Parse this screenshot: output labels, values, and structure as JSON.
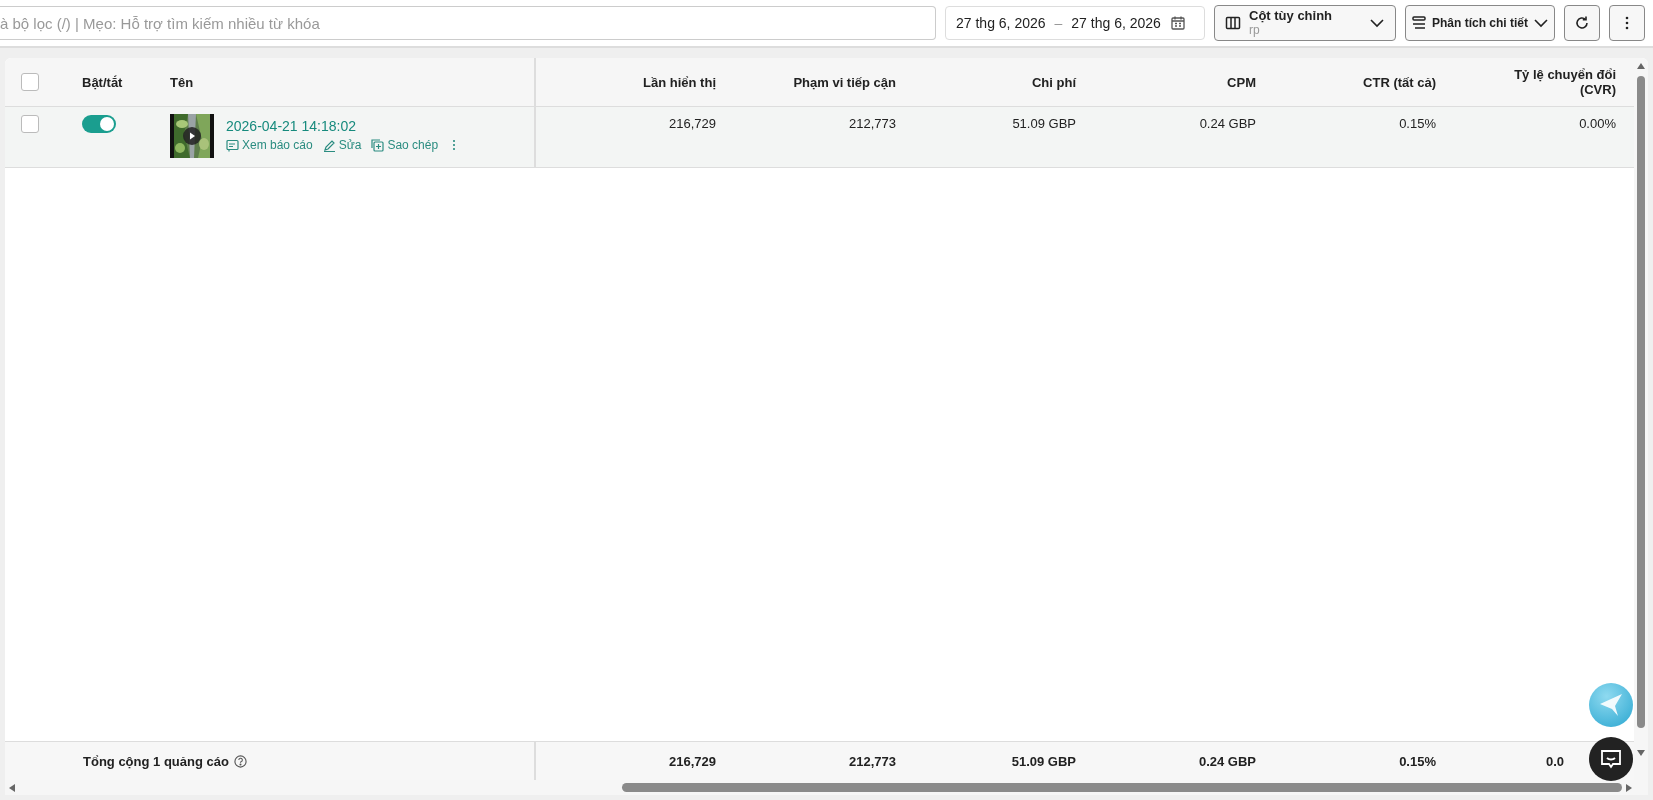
{
  "toolbar": {
    "search": {
      "placeholder": "à bộ lọc (/) | Mẹo: Hỗ trợ tìm kiếm nhiều từ khóa"
    },
    "date_range": {
      "start": "27 thg 6, 2026",
      "separator": "–",
      "end": "27 thg 6, 2026"
    },
    "custom_columns": {
      "label": "Cột tùy chỉnh",
      "sublabel": "rp"
    },
    "breakdown": {
      "label": "Phân tích chi tiết"
    }
  },
  "table": {
    "select_all_checked": false,
    "columns": [
      "Bật/tắt",
      "Tên",
      "Lần hiển thị",
      "Phạm vi tiếp cận",
      "Chi phí",
      "CPM",
      "CTR (tất cả)",
      "Tỷ lệ chuyển đổi (CVR)"
    ],
    "rows": [
      {
        "checked": false,
        "on": true,
        "name": "2026-04-21 14:18:02",
        "actions": [
          "Xem báo cáo",
          "Sửa",
          "Sao chép"
        ],
        "values": [
          "216,729",
          "212,773",
          "51.09 GBP",
          "0.24 GBP",
          "0.15%",
          "0.00%"
        ]
      }
    ],
    "footer": {
      "label": "Tổng cộng 1 quảng cáo",
      "values": [
        "216,729",
        "212,773",
        "51.09 GBP",
        "0.24 GBP",
        "0.15%",
        "0.0"
      ]
    }
  }
}
